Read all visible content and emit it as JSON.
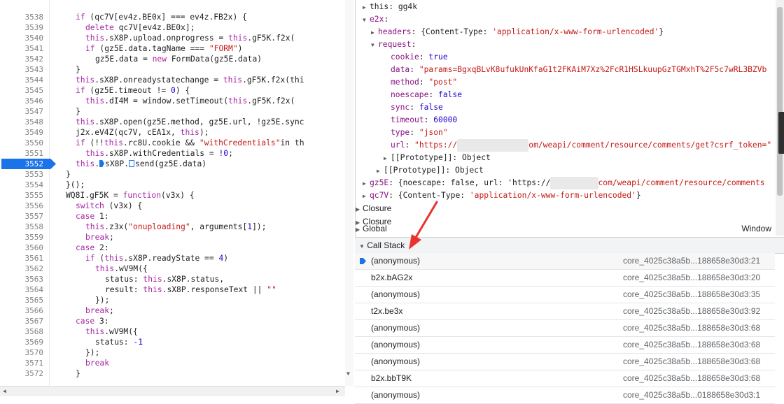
{
  "source": {
    "current_line": "3552",
    "lines": [
      {
        "n": "3538",
        "code": "if (qc7V[ev4z.BE0x] === ev4z.FB2x) {",
        "indent": 2
      },
      {
        "n": "3539",
        "code": "delete qc7V[ev4z.BE0x];",
        "indent": 3
      },
      {
        "n": "3540",
        "code": "this.sX8P.upload.onprogress = this.gF5K.f2x(",
        "indent": 3
      },
      {
        "n": "3541",
        "code": "if (gz5E.data.tagName === \"FORM\")",
        "indent": 3
      },
      {
        "n": "3542",
        "code": "gz5E.data = new FormData(gz5E.data)",
        "indent": 4
      },
      {
        "n": "3543",
        "code": "}",
        "indent": 2
      },
      {
        "n": "3544",
        "code": "this.sX8P.onreadystatechange = this.gF5K.f2x(thi",
        "indent": 2
      },
      {
        "n": "3545",
        "code": "if (gz5E.timeout != 0) {",
        "indent": 2
      },
      {
        "n": "3546",
        "code": "this.dI4M = window.setTimeout(this.gF5K.f2x(",
        "indent": 3
      },
      {
        "n": "3547",
        "code": "}",
        "indent": 2
      },
      {
        "n": "3548",
        "code": "this.sX8P.open(gz5E.method, gz5E.url, !gz5E.sync",
        "indent": 2
      },
      {
        "n": "3549",
        "code": "j2x.eV4Z(qc7V, cEA1x, this);",
        "indent": 2
      },
      {
        "n": "3550",
        "code": "if (!!this.rc8U.cookie && \"withCredentials\"in th",
        "indent": 2
      },
      {
        "n": "3551",
        "code": "this.sX8P.withCredentials = !0;",
        "indent": 3
      },
      {
        "n": "3552",
        "code": "this.",
        "indent": 2,
        "special": "current"
      },
      {
        "n": "3553",
        "code": "}",
        "indent": 1
      },
      {
        "n": "3554",
        "code": "}();",
        "indent": 1
      },
      {
        "n": "3555",
        "code": "WQ8I.gF5K = function(v3x) {",
        "indent": 1
      },
      {
        "n": "3556",
        "code": "switch (v3x) {",
        "indent": 2
      },
      {
        "n": "3557",
        "code": "case 1:",
        "indent": 2
      },
      {
        "n": "3558",
        "code": "this.z3x(\"onuploading\", arguments[1]);",
        "indent": 3
      },
      {
        "n": "3559",
        "code": "break;",
        "indent": 3
      },
      {
        "n": "3560",
        "code": "case 2:",
        "indent": 2
      },
      {
        "n": "3561",
        "code": "if (this.sX8P.readyState == 4)",
        "indent": 3
      },
      {
        "n": "3562",
        "code": "this.wV9M({",
        "indent": 4
      },
      {
        "n": "3563",
        "code": "status: this.sX8P.status,",
        "indent": 5
      },
      {
        "n": "3564",
        "code": "result: this.sX8P.responseText || \"\"",
        "indent": 5
      },
      {
        "n": "3565",
        "code": "});",
        "indent": 4
      },
      {
        "n": "3566",
        "code": "break;",
        "indent": 3
      },
      {
        "n": "3567",
        "code": "case 3:",
        "indent": 2
      },
      {
        "n": "3568",
        "code": "this.wV9M({",
        "indent": 3
      },
      {
        "n": "3569",
        "code": "status: -1",
        "indent": 4
      },
      {
        "n": "3570",
        "code": "});",
        "indent": 3
      },
      {
        "n": "3571",
        "code": "break",
        "indent": 3
      },
      {
        "n": "3572",
        "code": "}",
        "indent": 2
      }
    ],
    "current_parts": {
      "a": "this.",
      "b": "sX8P.",
      "c": "send(gz5E.data)"
    }
  },
  "scope": {
    "this_row": {
      "key": "this",
      "value": "gg4k"
    },
    "e2x": "e2x",
    "headers": {
      "key": "headers",
      "value": "{Content-Type: 'application/x-www-form-urlencoded'}"
    },
    "request": "request",
    "cookie": {
      "key": "cookie",
      "value": "true"
    },
    "data": {
      "key": "data",
      "value": "\"params=BgxqBLvK8ufukUnKfaG1t2FKAiM7Xz%2FcR1HSLkuupGzTGMxhT%2F5c7wRL3BZVb"
    },
    "method": {
      "key": "method",
      "value": "\"post\""
    },
    "noescape": {
      "key": "noescape",
      "value": "false"
    },
    "sync": {
      "key": "sync",
      "value": "false"
    },
    "timeout": {
      "key": "timeout",
      "value": "60000"
    },
    "type": {
      "key": "type",
      "value": "\"json\""
    },
    "url": {
      "key": "url",
      "value_a": "\"https://",
      "value_b": "om/weapi/comment/resource/comments/get?csrf_token=\""
    },
    "proto1": {
      "key": "[[Prototype]]",
      "value": "Object"
    },
    "proto2": {
      "key": "[[Prototype]]",
      "value": "Object"
    },
    "gz5E": {
      "key": "gz5E",
      "value_a": "{noescape: false, url: 'https://",
      "value_b": "com/weapi/comment/resource/comments"
    },
    "qc7V": {
      "key": "qc7V",
      "value": "{Content-Type: 'application/x-www-form-urlencoded'}"
    },
    "closure1": "Closure",
    "closure2": "Closure",
    "global": "Global",
    "window": "Window"
  },
  "call_stack": {
    "title": "Call Stack",
    "frames": [
      {
        "fn": "(anonymous)",
        "loc": "core_4025c38a5b...188658e30d3:21",
        "current": true
      },
      {
        "fn": "b2x.bAG2x",
        "loc": "core_4025c38a5b...188658e30d3:20"
      },
      {
        "fn": "(anonymous)",
        "loc": "core_4025c38a5b...188658e30d3:35"
      },
      {
        "fn": "t2x.be3x",
        "loc": "core_4025c38a5b...188658e30d3:92"
      },
      {
        "fn": "(anonymous)",
        "loc": "core_4025c38a5b...188658e30d3:68"
      },
      {
        "fn": "(anonymous)",
        "loc": "core_4025c38a5b...188658e30d3:68"
      },
      {
        "fn": "(anonymous)",
        "loc": "core_4025c38a5b...188658e30d3:68"
      },
      {
        "fn": "b2x.bbT9K",
        "loc": "core_4025c38a5b...188658e30d3:68"
      },
      {
        "fn": "(anonymous)",
        "loc": "core_4025c38a5b...0188658e30d3:1"
      }
    ]
  },
  "colors": {
    "accent": "#1a73e8",
    "annotation": "#e8332c"
  }
}
